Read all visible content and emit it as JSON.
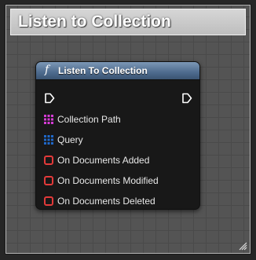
{
  "comment": {
    "title": "Listen to Collection",
    "color": "#c8c8c8"
  },
  "node": {
    "title": "Listen To Collection",
    "header_color": "#4e6b8e",
    "function_icon_glyph": "f",
    "exec_in_icon": "exec-input-pin-icon",
    "exec_out_icon": "exec-output-pin-icon",
    "pins": [
      {
        "label": "Collection Path",
        "icon": "string-array-pin-icon",
        "color": "#d63cd6"
      },
      {
        "label": "Query",
        "icon": "struct-pin-icon",
        "color": "#1f68c9"
      },
      {
        "label": "On Documents Added",
        "icon": "delegate-pin-icon",
        "color": "#e23a3a"
      },
      {
        "label": "On Documents Modified",
        "icon": "delegate-pin-icon",
        "color": "#e23a3a"
      },
      {
        "label": "On Documents Deleted",
        "icon": "delegate-pin-icon",
        "color": "#e23a3a"
      }
    ]
  }
}
